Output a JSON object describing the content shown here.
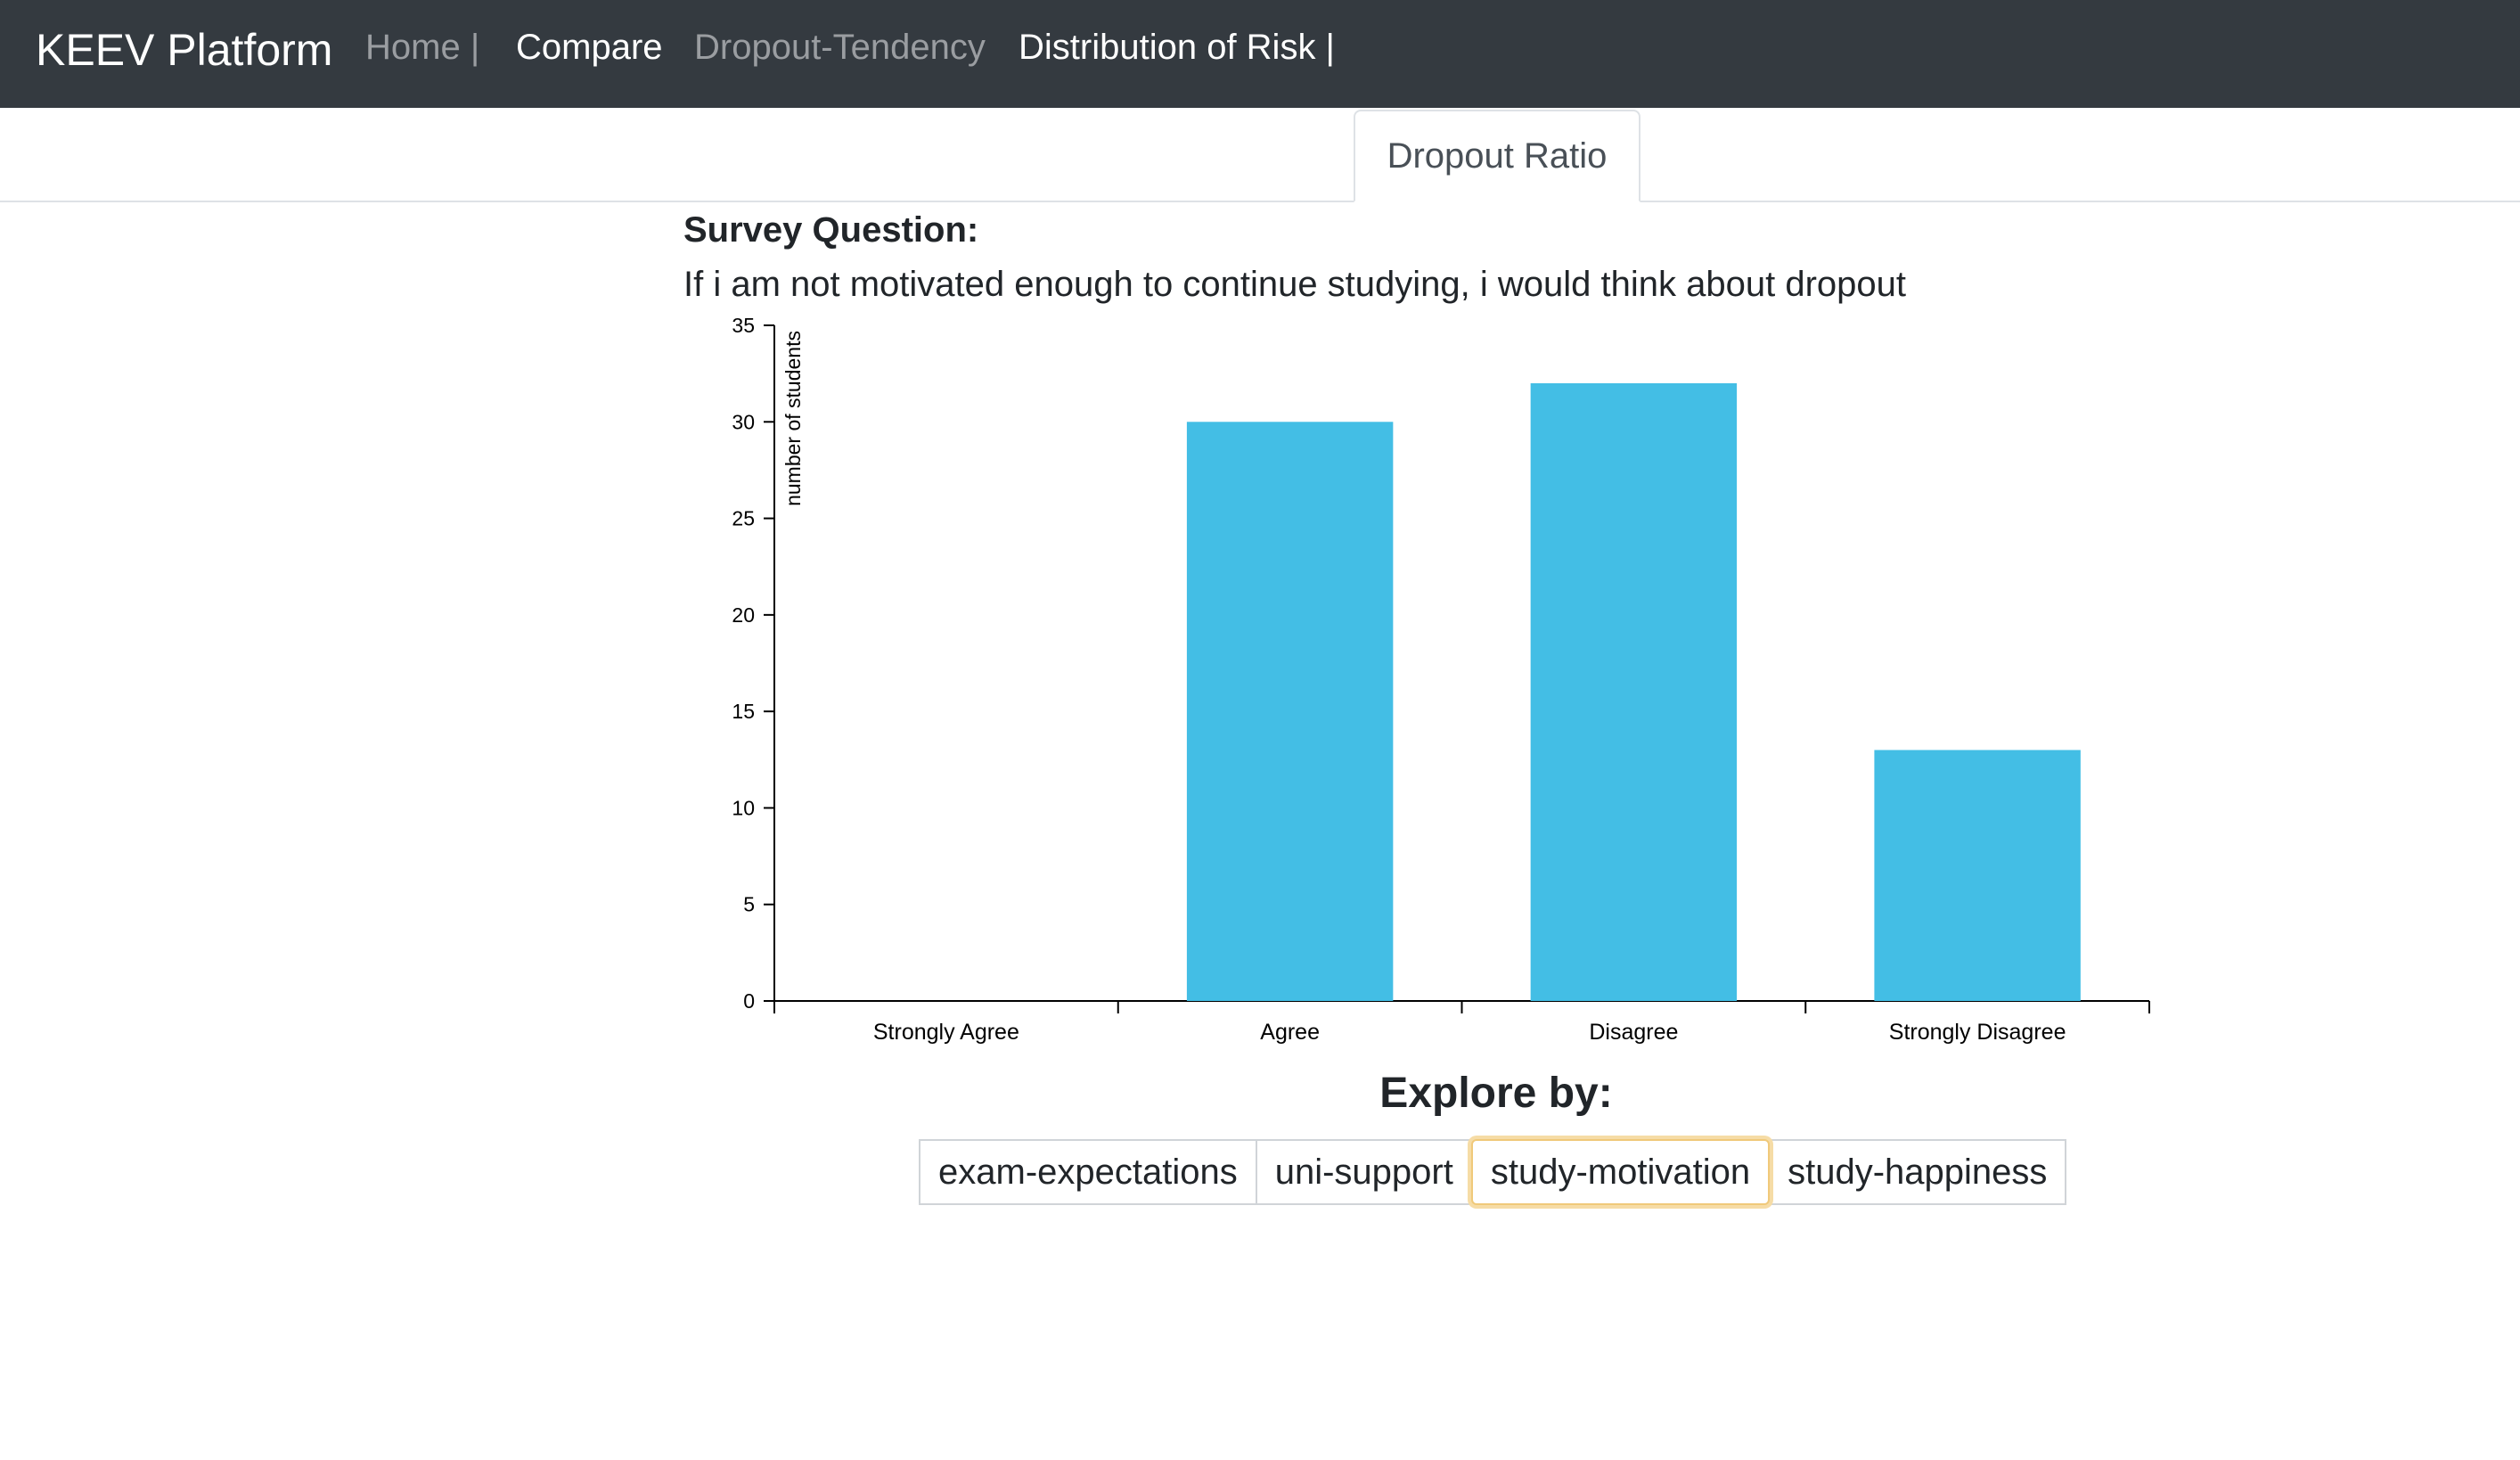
{
  "navbar": {
    "brand": "KEEV Platform",
    "links": [
      {
        "label": "Home |",
        "state": "muted"
      },
      {
        "label": "Compare",
        "state": "active"
      },
      {
        "label": "Dropout-Tendency",
        "state": "muted"
      },
      {
        "label": "Distribution of Risk |",
        "state": "active"
      }
    ]
  },
  "tabs": [
    {
      "label": "Dropout Ratio",
      "active": true
    }
  ],
  "survey": {
    "heading": "Survey Question:",
    "question": "If i am not motivated enough to continue studying, i would think about dropout"
  },
  "chart_data": {
    "type": "bar",
    "categories": [
      "Strongly Agree",
      "Agree",
      "Disagree",
      "Strongly Disagree"
    ],
    "values": [
      0,
      30,
      32,
      13
    ],
    "ylabel": "number of students",
    "ylim": [
      0,
      35
    ],
    "yticks": [
      0,
      5,
      10,
      15,
      20,
      25,
      30,
      35
    ],
    "bar_color": "#43bee5",
    "grid": false
  },
  "explore": {
    "label": "Explore by:",
    "options": [
      "exam-expectations",
      "uni-support",
      "study-motivation",
      "study-happiness"
    ],
    "selected": "study-motivation"
  },
  "colors": {
    "navbar_bg": "#343a40",
    "focus_ring": "#f0c97a"
  }
}
